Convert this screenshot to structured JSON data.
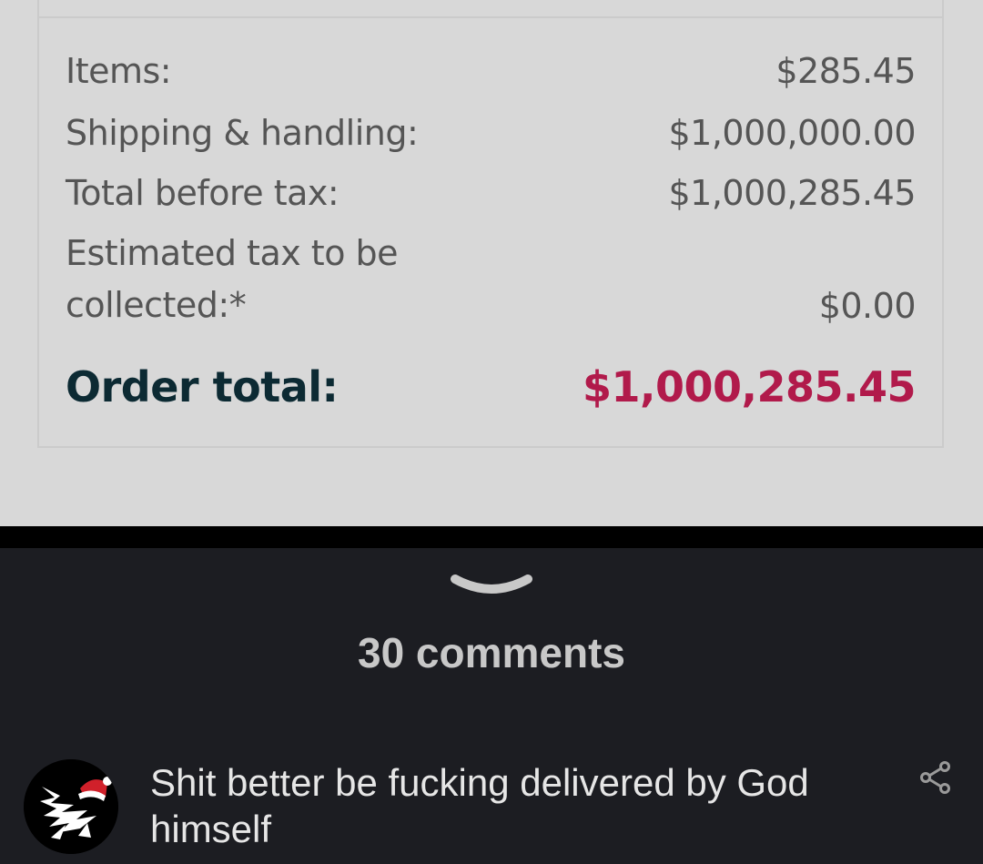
{
  "order_summary": {
    "items_label": "Items:",
    "items_value": "$285.45",
    "shipping_label": "Shipping & handling:",
    "shipping_value": "$1,000,000.00",
    "before_tax_label": "Total before tax:",
    "before_tax_value": "$1,000,285.45",
    "tax_label_line1": "Estimated tax to be",
    "tax_label_line2": "collected:*",
    "tax_value": "$0.00",
    "total_label": "Order total:",
    "total_value": "$1,000,285.45"
  },
  "post": {
    "comments_count": "30 comments"
  },
  "comment": {
    "text": "Shit better be fucking delivered by God himself",
    "avatar_icon": "user-avatar-icon",
    "share_icon": "share-icon"
  },
  "colors": {
    "order_total_value": "#b11a4b",
    "order_total_label": "#0c2a33",
    "dark_background": "#1c1d22"
  }
}
